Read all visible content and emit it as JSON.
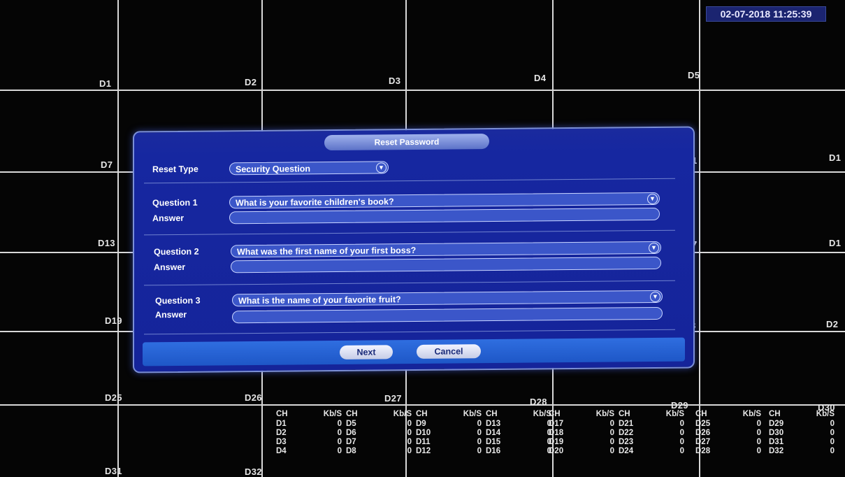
{
  "datetime": "02-07-2018 11:25:39",
  "channels": {
    "row1": [
      "D1",
      "D2",
      "D3",
      "D4",
      "D5"
    ],
    "row2": [
      "D7",
      "1",
      "D1"
    ],
    "row3": [
      "D13",
      "7",
      "D1"
    ],
    "row4": [
      "D19",
      "3",
      "D2"
    ],
    "row5": [
      "D25",
      "D26",
      "D27",
      "D28",
      "D29",
      "D30"
    ],
    "row6": [
      "D31",
      "D32"
    ]
  },
  "dialog": {
    "title": "Reset Password",
    "reset_type_label": "Reset Type",
    "reset_type_value": "Security Question",
    "questions": [
      {
        "label": "Question 1",
        "value": "What is your favorite children's book?",
        "answer_label": "Answer"
      },
      {
        "label": "Question 2",
        "value": "What was the first name of your first boss?",
        "answer_label": "Answer"
      },
      {
        "label": "Question 3",
        "value": "What is the name of your favorite fruit?",
        "answer_label": "Answer"
      }
    ],
    "next_label": "Next",
    "cancel_label": "Cancel"
  },
  "stats": {
    "header_ch": "CH",
    "header_kbs": "Kb/S",
    "columns": [
      [
        [
          "D1",
          "0"
        ],
        [
          "D2",
          "0"
        ],
        [
          "D3",
          "0"
        ],
        [
          "D4",
          "0"
        ]
      ],
      [
        [
          "D5",
          "0"
        ],
        [
          "D6",
          "0"
        ],
        [
          "D7",
          "0"
        ],
        [
          "D8",
          "0"
        ]
      ],
      [
        [
          "D9",
          "0"
        ],
        [
          "D10",
          "0"
        ],
        [
          "D11",
          "0"
        ],
        [
          "D12",
          "0"
        ]
      ],
      [
        [
          "D13",
          "0"
        ],
        [
          "D14",
          "0"
        ],
        [
          "D15",
          "0"
        ],
        [
          "D16",
          "0"
        ]
      ],
      [
        [
          "D17",
          "0"
        ],
        [
          "D18",
          "0"
        ],
        [
          "D19",
          "0"
        ],
        [
          "D20",
          "0"
        ]
      ],
      [
        [
          "D21",
          "0"
        ],
        [
          "D22",
          "0"
        ],
        [
          "D23",
          "0"
        ],
        [
          "D24",
          "0"
        ]
      ],
      [
        [
          "D25",
          "0"
        ],
        [
          "D26",
          "0"
        ],
        [
          "D27",
          "0"
        ],
        [
          "D28",
          "0"
        ]
      ],
      [
        [
          "D29",
          "0"
        ],
        [
          "D30",
          "0"
        ],
        [
          "D31",
          "0"
        ],
        [
          "D32",
          "0"
        ]
      ]
    ]
  }
}
